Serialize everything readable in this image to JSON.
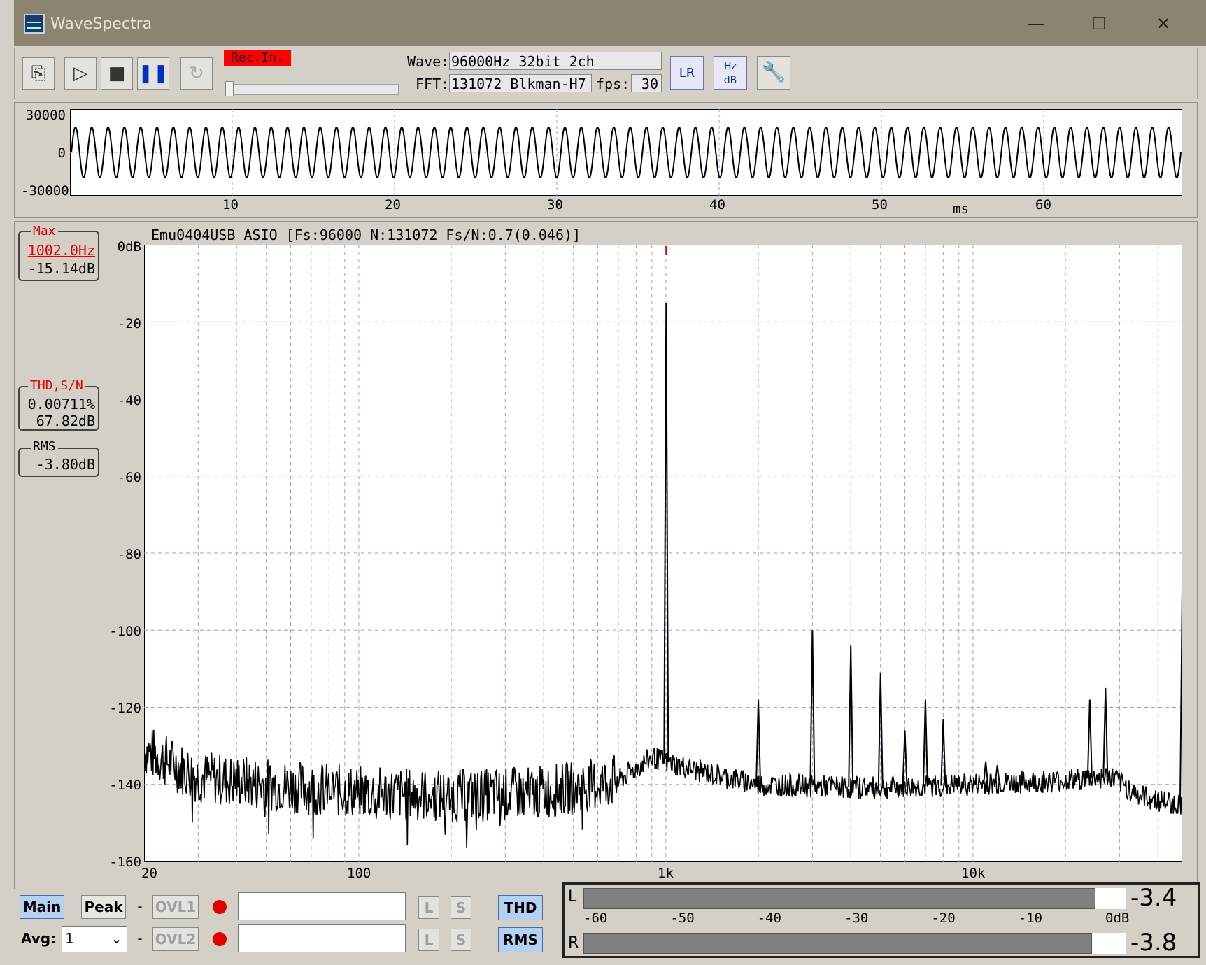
{
  "window": {
    "title": "WaveSpectra",
    "minimize": "—",
    "maximize": "☐",
    "close": "✕"
  },
  "toolbar": {
    "rec_label": "Rec.In.",
    "wave_label": "Wave:",
    "wave_value": "96000Hz 32bit 2ch",
    "fft_label": "FFT:",
    "fft_value": "131072 Blkman-H7",
    "fps_label": "fps:",
    "fps_value": "30",
    "lr_icon": "LR",
    "hzdb_icon_top": "Hz",
    "hzdb_icon_bottom": "dB"
  },
  "wave_plot": {
    "y_ticks": [
      "30000",
      "0",
      "-30000"
    ],
    "x_ticks": [
      "10",
      "20",
      "30",
      "40",
      "50",
      "60"
    ],
    "x_unit": "ms",
    "cycles": 68
  },
  "spectrum": {
    "header": "Emu0404USB ASIO   [Fs:96000 N:131072 Fs/N:0.7(0.046)]",
    "y_ticks": [
      "0dB",
      "-20",
      "-40",
      "-60",
      "-80",
      "-100",
      "-120",
      "-140",
      "-160"
    ],
    "x_ticks": [
      "20",
      "100",
      "1k",
      "10k"
    ],
    "max_box": {
      "title": "Max",
      "freq": "1002.0Hz",
      "level": "-15.14dB"
    },
    "thd_box": {
      "title": "THD,S/N",
      "thd": "0.00711%",
      "sn": "67.82dB"
    },
    "rms_box": {
      "title": "RMS",
      "value": "-3.80dB"
    }
  },
  "chart_data": {
    "type": "line",
    "title": "Emu0404USB ASIO   [Fs:96000 N:131072 Fs/N:0.7(0.046)]",
    "xlabel": "",
    "ylabel": "",
    "x_scale": "log",
    "xlim": [
      20,
      48000
    ],
    "ylim": [
      -160,
      0
    ],
    "grid": true,
    "peaks": [
      {
        "x": 1002,
        "y": -15.14
      },
      {
        "x": 2000,
        "y": -118
      },
      {
        "x": 3000,
        "y": -100
      },
      {
        "x": 4000,
        "y": -104
      },
      {
        "x": 5000,
        "y": -111
      },
      {
        "x": 6000,
        "y": -126
      },
      {
        "x": 7000,
        "y": -118
      },
      {
        "x": 8000,
        "y": -123
      },
      {
        "x": 11000,
        "y": -134
      },
      {
        "x": 12000,
        "y": -135
      },
      {
        "x": 24000,
        "y": -118
      },
      {
        "x": 27000,
        "y": -115
      },
      {
        "x": 48000,
        "y": -89
      }
    ],
    "noise_floor": [
      {
        "x": 20,
        "y": -131
      },
      {
        "x": 30,
        "y": -138
      },
      {
        "x": 50,
        "y": -140
      },
      {
        "x": 100,
        "y": -142
      },
      {
        "x": 200,
        "y": -143
      },
      {
        "x": 400,
        "y": -142
      },
      {
        "x": 700,
        "y": -139
      },
      {
        "x": 900,
        "y": -133
      },
      {
        "x": 1200,
        "y": -136
      },
      {
        "x": 2000,
        "y": -140
      },
      {
        "x": 5000,
        "y": -141
      },
      {
        "x": 10000,
        "y": -140
      },
      {
        "x": 20000,
        "y": -139
      },
      {
        "x": 28000,
        "y": -138
      },
      {
        "x": 35000,
        "y": -143
      },
      {
        "x": 45000,
        "y": -145
      }
    ]
  },
  "bottom": {
    "main": "Main",
    "peak": "Peak",
    "dash": "-",
    "avg_label": "Avg:",
    "avg_value": "1",
    "ovl1": "OVL1",
    "ovl2": "OVL2",
    "l": "L",
    "s": "S",
    "thd": "THD",
    "rms": "RMS"
  },
  "meter": {
    "l_label": "L",
    "r_label": "R",
    "l_value": "-3.4",
    "r_value": "-3.8",
    "scale": [
      "-60",
      "-50",
      "-40",
      "-30",
      "-20",
      "-10",
      "0dB"
    ],
    "l_level": -3.4,
    "r_level": -3.8
  }
}
